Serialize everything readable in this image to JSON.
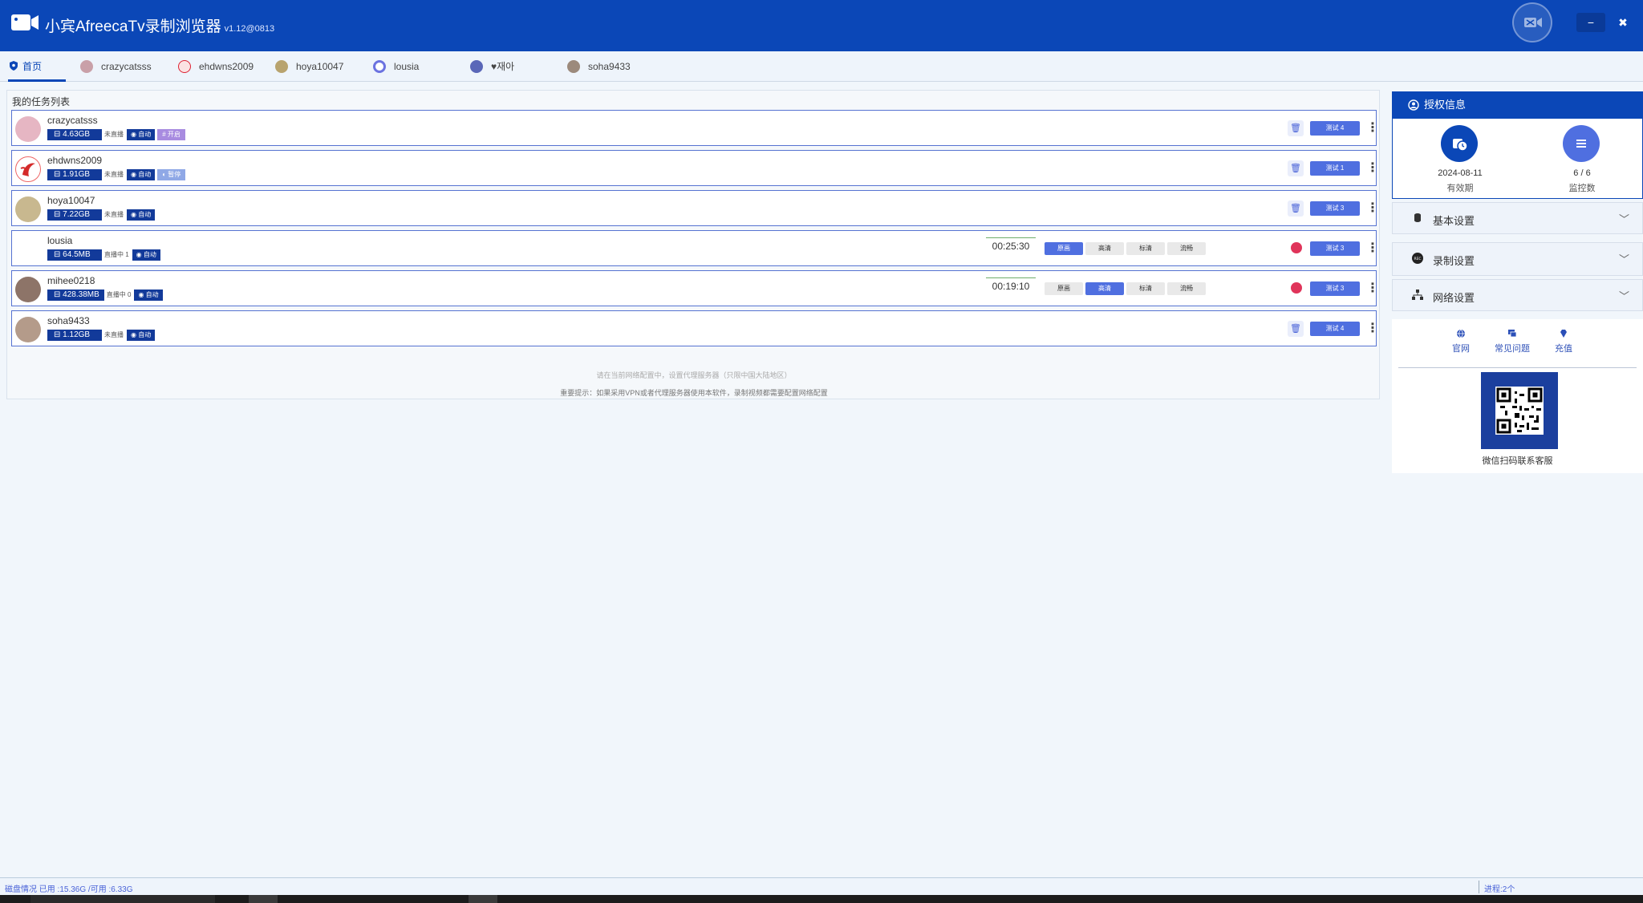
{
  "app": {
    "title": "小宾AfreecaTv录制浏览器",
    "version": "v1.12@0813",
    "minimize_label": "−",
    "close_label": "✖"
  },
  "tabs": [
    {
      "label": "首页",
      "active": true
    },
    {
      "label": "crazycatsss"
    },
    {
      "label": "ehdwns2009"
    },
    {
      "label": "hoya10047"
    },
    {
      "label": "lousia"
    },
    {
      "label": "♥재아"
    },
    {
      "label": "soha9433"
    }
  ],
  "task_list": {
    "title": "我的任务列表",
    "rows": [
      {
        "name": "crazycatsss",
        "size": "4.63GB",
        "status": "未直播",
        "auto": "自动",
        "tag": "开启",
        "speed": "测试 4"
      },
      {
        "name": "ehdwns2009",
        "size": "1.91GB",
        "status": "未直播",
        "auto": "自动",
        "tag": "暂停",
        "speed": "测试 1"
      },
      {
        "name": "hoya10047",
        "size": "7.22GB",
        "status": "未直播",
        "auto": "自动",
        "speed": "测试 3"
      },
      {
        "name": "lousia",
        "size": "64.5MB",
        "status": "直播中 1",
        "auto": "自动",
        "timer": "00:25:30",
        "quality": [
          "原画",
          "高清",
          "标清",
          "流畅"
        ],
        "quality_selected": 0,
        "speed": "测试 3"
      },
      {
        "name": "mihee0218",
        "size": "428.38MB",
        "status": "直播中 0",
        "auto": "自动",
        "timer": "00:19:10",
        "quality": [
          "原画",
          "高清",
          "标清",
          "流畅"
        ],
        "quality_selected": 1,
        "speed": "测试 3"
      },
      {
        "name": "soha9433",
        "size": "1.12GB",
        "status": "未直播",
        "auto": "自动",
        "speed": "测试 4"
      }
    ],
    "hint_1": "请在当前网络配置中，设置代理服务器（只限中国大陆地区）",
    "hint_2": "重要提示：如果采用VPN或者代理服务器使用本软件，录制视频都需要配置网络配置"
  },
  "auth": {
    "title": "授权信息",
    "expiry_value": "2024-08-11",
    "expiry_label": "有效期",
    "monitor_value": "6 / 6",
    "monitor_label": "监控数"
  },
  "settings": [
    {
      "label": "基本设置",
      "icon": "database-icon"
    },
    {
      "label": "录制设置",
      "icon": "rec-icon"
    },
    {
      "label": "网络设置",
      "icon": "network-icon"
    }
  ],
  "links": [
    {
      "label": "官网",
      "icon": "globe-icon"
    },
    {
      "label": "常见问题",
      "icon": "chat-icon"
    },
    {
      "label": "充值",
      "icon": "diamond-icon"
    }
  ],
  "qr_caption": "微信扫码联系客服",
  "statusbar": {
    "disk": "磁盘情况  已用 :15.36G /可用 :6.33G",
    "progress": "进程:2个"
  },
  "colors": {
    "brand": "#0b47b7",
    "accent": "#4f6fe0",
    "recording": "#e0345a"
  }
}
